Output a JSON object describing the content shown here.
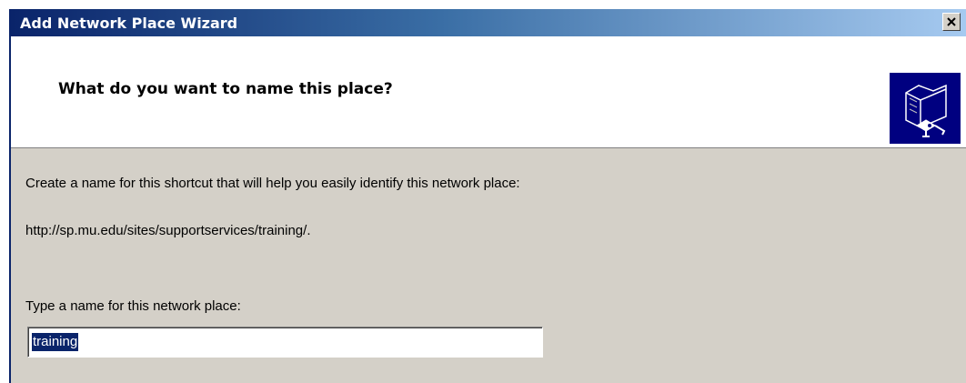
{
  "window": {
    "title": "Add Network Place Wizard",
    "close_label": "×"
  },
  "header": {
    "heading": "What do you want to name this place?",
    "icon": "network-folder-icon"
  },
  "content": {
    "instruction": "Create a name for this shortcut that will help you easily identify this network place:",
    "address": "http://sp.mu.edu/sites/supportservices/training/.",
    "name_label": "Type a name for this network place:",
    "name_value": "training"
  },
  "colors": {
    "title_gradient_start": "#0a246a",
    "title_gradient_end": "#a6caf0",
    "dialog_background": "#d4d0c8",
    "selection": "#0a246a",
    "icon_background": "#000080"
  }
}
